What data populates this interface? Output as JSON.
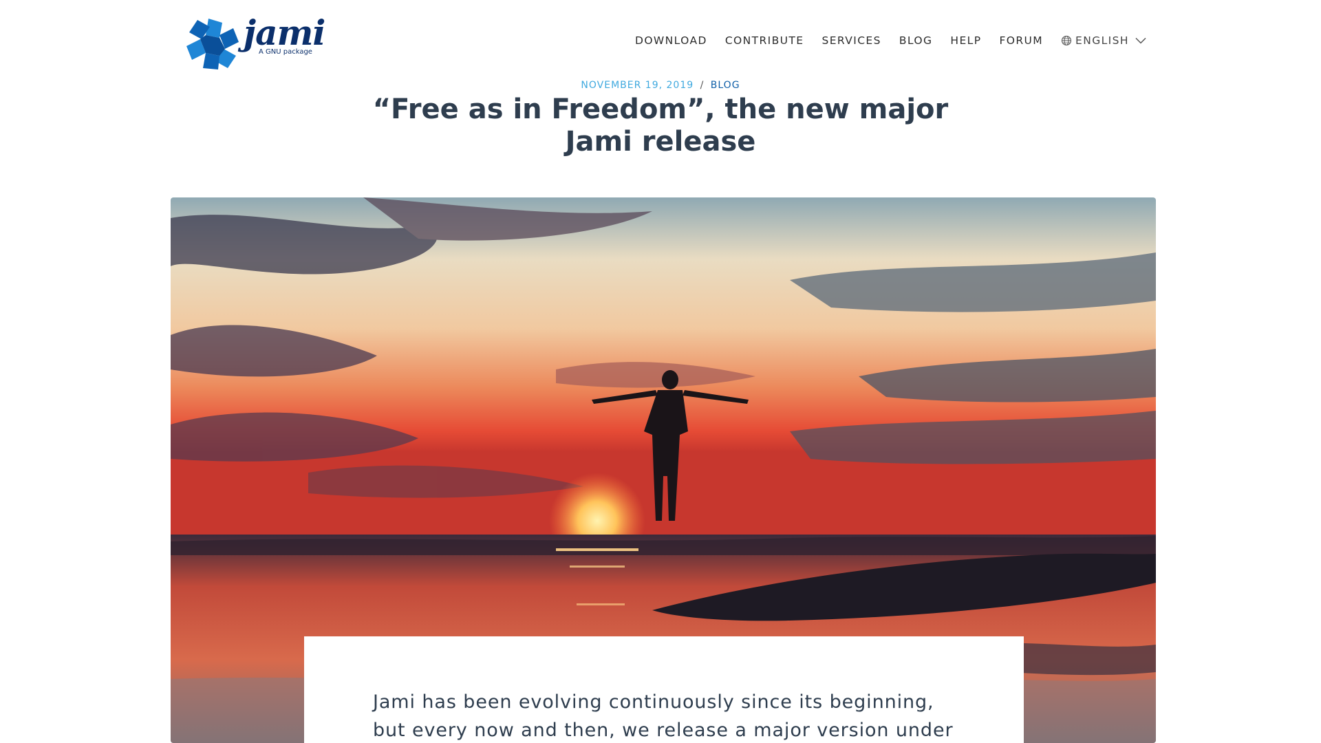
{
  "brand": {
    "name": "jami",
    "tagline": "A GNU package"
  },
  "nav": {
    "items": [
      "DOWNLOAD",
      "CONTRIBUTE",
      "SERVICES",
      "BLOG",
      "HELP",
      "FORUM"
    ],
    "language": "ENGLISH"
  },
  "post": {
    "date": "NOVEMBER 19, 2019",
    "separator": "/",
    "category": "BLOG",
    "title": "“Free as in Freedom”, the new major Jami release",
    "lead": "Jami has been evolving continuously since its beginning, but every now and then, we release a major version under"
  },
  "hero": {
    "icon": "sunset-silhouette-image"
  },
  "colors": {
    "accent": "#3fa9df",
    "category": "#0f5fa8",
    "title": "#2e3d4e",
    "brand": "#0b2f6b"
  }
}
